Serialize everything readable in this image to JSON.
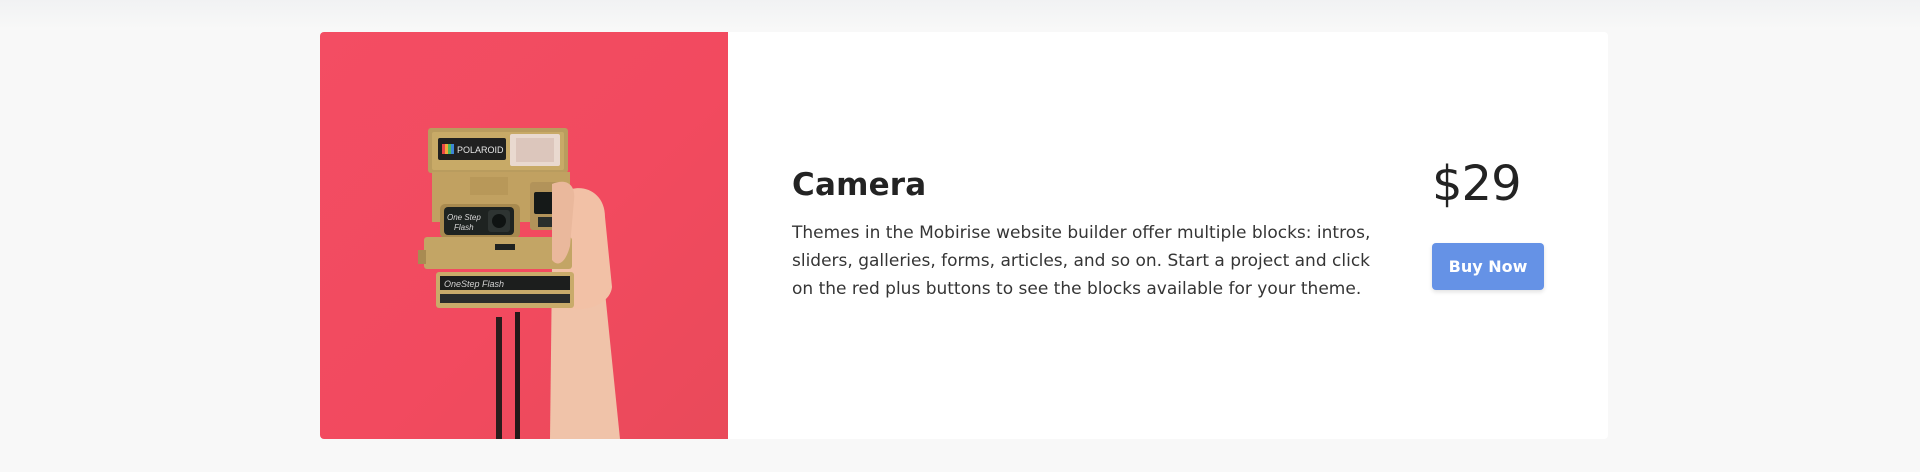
{
  "product": {
    "title": "Camera",
    "description": "Themes in the Mobirise website builder offer multiple blocks: intros, sliders, galleries, forms, articles, and so on. Start a project and click on the red plus buttons to see the blocks available for your theme.",
    "price": "$29",
    "buy_label": "Buy Now",
    "image": {
      "subject": "hand-holding-polaroid-camera",
      "brand_text": "POLAROID",
      "model_text": "One Step Flash",
      "model_text_front": "OneStep Flash",
      "background_color": "#f34d63"
    }
  },
  "colors": {
    "button": "#6592e6",
    "text": "#232323",
    "page_bg": "#f8f8f8"
  }
}
